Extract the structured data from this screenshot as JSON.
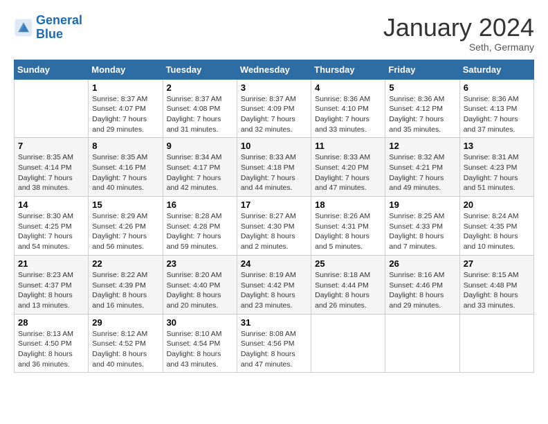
{
  "logo": {
    "line1": "General",
    "line2": "Blue"
  },
  "title": "January 2024",
  "location": "Seth, Germany",
  "days_header": [
    "Sunday",
    "Monday",
    "Tuesday",
    "Wednesday",
    "Thursday",
    "Friday",
    "Saturday"
  ],
  "weeks": [
    [
      {
        "num": "",
        "info": ""
      },
      {
        "num": "1",
        "info": "Sunrise: 8:37 AM\nSunset: 4:07 PM\nDaylight: 7 hours\nand 29 minutes."
      },
      {
        "num": "2",
        "info": "Sunrise: 8:37 AM\nSunset: 4:08 PM\nDaylight: 7 hours\nand 31 minutes."
      },
      {
        "num": "3",
        "info": "Sunrise: 8:37 AM\nSunset: 4:09 PM\nDaylight: 7 hours\nand 32 minutes."
      },
      {
        "num": "4",
        "info": "Sunrise: 8:36 AM\nSunset: 4:10 PM\nDaylight: 7 hours\nand 33 minutes."
      },
      {
        "num": "5",
        "info": "Sunrise: 8:36 AM\nSunset: 4:12 PM\nDaylight: 7 hours\nand 35 minutes."
      },
      {
        "num": "6",
        "info": "Sunrise: 8:36 AM\nSunset: 4:13 PM\nDaylight: 7 hours\nand 37 minutes."
      }
    ],
    [
      {
        "num": "7",
        "info": "Sunrise: 8:35 AM\nSunset: 4:14 PM\nDaylight: 7 hours\nand 38 minutes."
      },
      {
        "num": "8",
        "info": "Sunrise: 8:35 AM\nSunset: 4:16 PM\nDaylight: 7 hours\nand 40 minutes."
      },
      {
        "num": "9",
        "info": "Sunrise: 8:34 AM\nSunset: 4:17 PM\nDaylight: 7 hours\nand 42 minutes."
      },
      {
        "num": "10",
        "info": "Sunrise: 8:33 AM\nSunset: 4:18 PM\nDaylight: 7 hours\nand 44 minutes."
      },
      {
        "num": "11",
        "info": "Sunrise: 8:33 AM\nSunset: 4:20 PM\nDaylight: 7 hours\nand 47 minutes."
      },
      {
        "num": "12",
        "info": "Sunrise: 8:32 AM\nSunset: 4:21 PM\nDaylight: 7 hours\nand 49 minutes."
      },
      {
        "num": "13",
        "info": "Sunrise: 8:31 AM\nSunset: 4:23 PM\nDaylight: 7 hours\nand 51 minutes."
      }
    ],
    [
      {
        "num": "14",
        "info": "Sunrise: 8:30 AM\nSunset: 4:25 PM\nDaylight: 7 hours\nand 54 minutes."
      },
      {
        "num": "15",
        "info": "Sunrise: 8:29 AM\nSunset: 4:26 PM\nDaylight: 7 hours\nand 56 minutes."
      },
      {
        "num": "16",
        "info": "Sunrise: 8:28 AM\nSunset: 4:28 PM\nDaylight: 7 hours\nand 59 minutes."
      },
      {
        "num": "17",
        "info": "Sunrise: 8:27 AM\nSunset: 4:30 PM\nDaylight: 8 hours\nand 2 minutes."
      },
      {
        "num": "18",
        "info": "Sunrise: 8:26 AM\nSunset: 4:31 PM\nDaylight: 8 hours\nand 5 minutes."
      },
      {
        "num": "19",
        "info": "Sunrise: 8:25 AM\nSunset: 4:33 PM\nDaylight: 8 hours\nand 7 minutes."
      },
      {
        "num": "20",
        "info": "Sunrise: 8:24 AM\nSunset: 4:35 PM\nDaylight: 8 hours\nand 10 minutes."
      }
    ],
    [
      {
        "num": "21",
        "info": "Sunrise: 8:23 AM\nSunset: 4:37 PM\nDaylight: 8 hours\nand 13 minutes."
      },
      {
        "num": "22",
        "info": "Sunrise: 8:22 AM\nSunset: 4:39 PM\nDaylight: 8 hours\nand 16 minutes."
      },
      {
        "num": "23",
        "info": "Sunrise: 8:20 AM\nSunset: 4:40 PM\nDaylight: 8 hours\nand 20 minutes."
      },
      {
        "num": "24",
        "info": "Sunrise: 8:19 AM\nSunset: 4:42 PM\nDaylight: 8 hours\nand 23 minutes."
      },
      {
        "num": "25",
        "info": "Sunrise: 8:18 AM\nSunset: 4:44 PM\nDaylight: 8 hours\nand 26 minutes."
      },
      {
        "num": "26",
        "info": "Sunrise: 8:16 AM\nSunset: 4:46 PM\nDaylight: 8 hours\nand 29 minutes."
      },
      {
        "num": "27",
        "info": "Sunrise: 8:15 AM\nSunset: 4:48 PM\nDaylight: 8 hours\nand 33 minutes."
      }
    ],
    [
      {
        "num": "28",
        "info": "Sunrise: 8:13 AM\nSunset: 4:50 PM\nDaylight: 8 hours\nand 36 minutes."
      },
      {
        "num": "29",
        "info": "Sunrise: 8:12 AM\nSunset: 4:52 PM\nDaylight: 8 hours\nand 40 minutes."
      },
      {
        "num": "30",
        "info": "Sunrise: 8:10 AM\nSunset: 4:54 PM\nDaylight: 8 hours\nand 43 minutes."
      },
      {
        "num": "31",
        "info": "Sunrise: 8:08 AM\nSunset: 4:56 PM\nDaylight: 8 hours\nand 47 minutes."
      },
      {
        "num": "",
        "info": ""
      },
      {
        "num": "",
        "info": ""
      },
      {
        "num": "",
        "info": ""
      }
    ]
  ]
}
